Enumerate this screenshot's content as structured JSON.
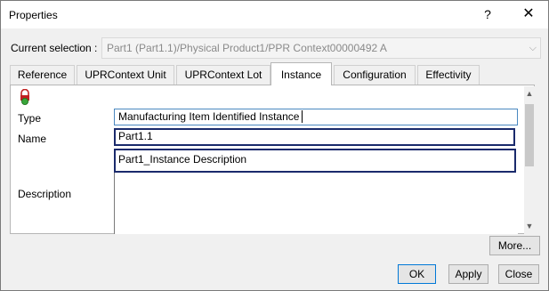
{
  "window": {
    "title": "Properties",
    "help_glyph": "?",
    "close_glyph": "✕"
  },
  "selection": {
    "label": "Current selection :",
    "value": "Part1 (Part1.1)/Physical Product1/PPR Context00000492 A",
    "arrow_glyph": "⌵"
  },
  "tabs": [
    {
      "label": "Reference",
      "active": false
    },
    {
      "label": "UPRContext Unit",
      "active": false
    },
    {
      "label": "UPRContext Lot",
      "active": false
    },
    {
      "label": "Instance",
      "active": true
    },
    {
      "label": "Configuration",
      "active": false
    },
    {
      "label": "Effectivity",
      "active": false
    }
  ],
  "form": {
    "type_label": "Type",
    "type_value": "Manufacturing Item Identified Instance",
    "name_label": "Name",
    "name_value": "Part1.1",
    "description_label": "Description",
    "description_value": "Part1_Instance Description"
  },
  "scroll": {
    "up_glyph": "▲",
    "down_glyph": "▼"
  },
  "buttons": {
    "more": "More...",
    "ok": "OK",
    "apply": "Apply",
    "close": "Close"
  },
  "colors": {
    "highlight_border": "#1a2a6c",
    "lock_body": "#c02020",
    "lock_badge": "#3aa53a"
  }
}
